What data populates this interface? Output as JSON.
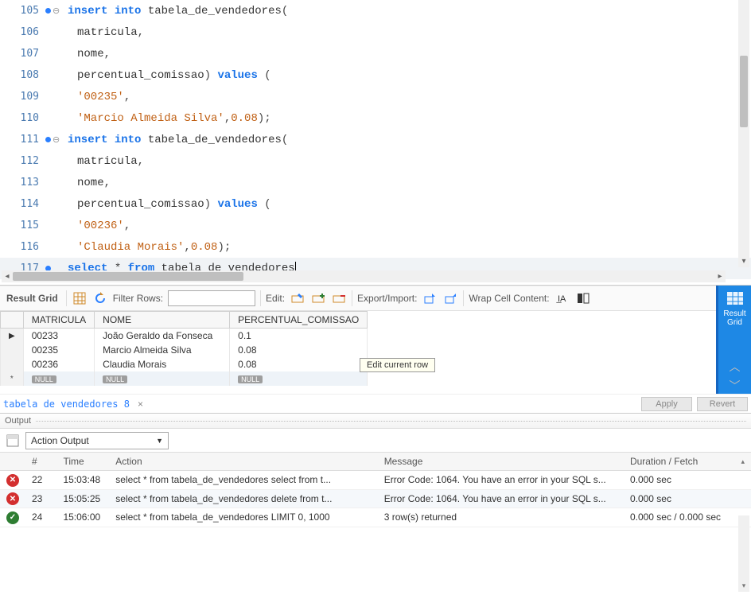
{
  "editor": {
    "lines": [
      {
        "num": "105",
        "marker": "dot",
        "fold": true,
        "tokens": [
          [
            "kw",
            "insert"
          ],
          [
            "sp",
            " "
          ],
          [
            "kw",
            "into"
          ],
          [
            "sp",
            " "
          ],
          [
            "ident",
            "tabela_de_vendedores"
          ],
          [
            "punc",
            "("
          ]
        ]
      },
      {
        "num": "106",
        "indent": true,
        "tokens": [
          [
            "ident",
            "matricula"
          ],
          [
            "punc",
            ","
          ]
        ]
      },
      {
        "num": "107",
        "indent": true,
        "tokens": [
          [
            "ident",
            "nome"
          ],
          [
            "punc",
            ","
          ]
        ]
      },
      {
        "num": "108",
        "indent": true,
        "tokens": [
          [
            "ident",
            "percentual_comissao"
          ],
          [
            "punc",
            ")"
          ],
          [
            "sp",
            " "
          ],
          [
            "kw",
            "values"
          ],
          [
            "sp",
            " "
          ],
          [
            "punc",
            "("
          ]
        ]
      },
      {
        "num": "109",
        "indent": true,
        "tokens": [
          [
            "str",
            "'00235'"
          ],
          [
            "punc",
            ","
          ]
        ]
      },
      {
        "num": "110",
        "indent": true,
        "tokens": [
          [
            "str",
            "'Marcio Almeida Silva'"
          ],
          [
            "punc",
            ","
          ],
          [
            "num",
            "0.08"
          ],
          [
            "punc",
            ");"
          ]
        ]
      },
      {
        "num": "111",
        "marker": "dot",
        "fold": true,
        "tokens": [
          [
            "kw",
            "insert"
          ],
          [
            "sp",
            " "
          ],
          [
            "kw",
            "into"
          ],
          [
            "sp",
            " "
          ],
          [
            "ident",
            "tabela_de_vendedores"
          ],
          [
            "punc",
            "("
          ]
        ]
      },
      {
        "num": "112",
        "indent": true,
        "tokens": [
          [
            "ident",
            "matricula"
          ],
          [
            "punc",
            ","
          ]
        ]
      },
      {
        "num": "113",
        "indent": true,
        "tokens": [
          [
            "ident",
            "nome"
          ],
          [
            "punc",
            ","
          ]
        ]
      },
      {
        "num": "114",
        "indent": true,
        "tokens": [
          [
            "ident",
            "percentual_comissao"
          ],
          [
            "punc",
            ")"
          ],
          [
            "sp",
            " "
          ],
          [
            "kw",
            "values"
          ],
          [
            "sp",
            " "
          ],
          [
            "punc",
            "("
          ]
        ]
      },
      {
        "num": "115",
        "indent": true,
        "tokens": [
          [
            "str",
            "'00236'"
          ],
          [
            "punc",
            ","
          ]
        ]
      },
      {
        "num": "116",
        "indent": true,
        "tokens": [
          [
            "str",
            "'Claudia Morais'"
          ],
          [
            "punc",
            ","
          ],
          [
            "num",
            "0.08"
          ],
          [
            "punc",
            ");"
          ]
        ]
      },
      {
        "num": "117",
        "marker": "dot",
        "cursor": true,
        "tokens": [
          [
            "kw",
            "select"
          ],
          [
            "sp",
            " "
          ],
          [
            "punc",
            "*"
          ],
          [
            "sp",
            " "
          ],
          [
            "kw",
            "from"
          ],
          [
            "sp",
            " "
          ],
          [
            "ident",
            "tabela_de_vendedores"
          ]
        ]
      }
    ]
  },
  "toolbar": {
    "result_grid_label": "Result Grid",
    "filter_rows_label": "Filter Rows:",
    "edit_label": "Edit:",
    "export_label": "Export/Import:",
    "wrap_label": "Wrap Cell Content:",
    "filter_value": ""
  },
  "grid": {
    "columns": [
      "MATRICULA",
      "NOME",
      "PERCENTUAL_COMISSAO"
    ],
    "rows": [
      {
        "sel": "▶",
        "c": [
          "00233",
          "João Geraldo da Fonseca",
          "0.1"
        ]
      },
      {
        "sel": "",
        "c": [
          "00235",
          "Marcio Almeida Silva",
          "0.08"
        ]
      },
      {
        "sel": "",
        "c": [
          "00236",
          "Claudia Morais",
          "0.08"
        ]
      }
    ],
    "null_row_label": "NULL",
    "null_selector": "*"
  },
  "tooltip": "Edit current row",
  "side_tab": {
    "title1": "Result",
    "title2": "Grid"
  },
  "tab": {
    "name": "tabela de vendedores 8",
    "apply": "Apply",
    "revert": "Revert"
  },
  "output": {
    "title": "Output",
    "dropdown": "Action Output",
    "columns": [
      "#",
      "Time",
      "Action",
      "Message",
      "Duration / Fetch"
    ],
    "rows": [
      {
        "status": "err",
        "n": "22",
        "time": "15:03:48",
        "action": "select * from tabela_de_vendedores  select from t...",
        "msg": "Error Code: 1064. You have an error in your SQL s...",
        "dur": "0.000 sec"
      },
      {
        "status": "err",
        "n": "23",
        "time": "15:05:25",
        "action": "select * from tabela_de_vendedores  delete from t...",
        "msg": "Error Code: 1064. You have an error in your SQL s...",
        "dur": "0.000 sec"
      },
      {
        "status": "ok",
        "n": "24",
        "time": "15:06:00",
        "action": "select * from tabela_de_vendedores LIMIT 0, 1000",
        "msg": "3 row(s) returned",
        "dur": "0.000 sec / 0.000 sec"
      }
    ]
  }
}
